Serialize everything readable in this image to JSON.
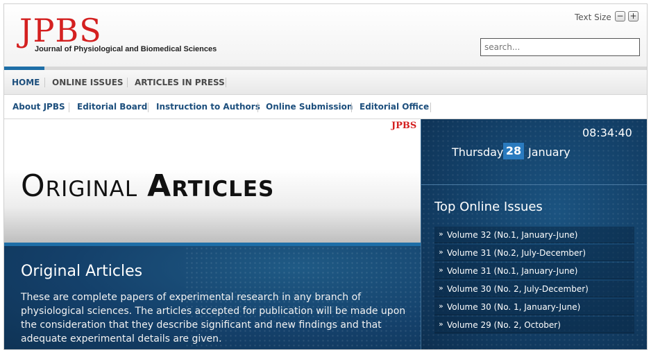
{
  "brand": {
    "logo": "JPBS",
    "subtitle": "Journal of Physiological and Biomedical Sciences",
    "color": "#d42020"
  },
  "header": {
    "text_size_label": "Text Size",
    "decrease_glyph": "−",
    "increase_glyph": "+",
    "search_placeholder": "search..."
  },
  "nav_primary": {
    "active_color": "#1e6ea7",
    "items": [
      {
        "label": "HOME",
        "active": true
      },
      {
        "label": "ONLINE ISSUES",
        "active": false
      },
      {
        "label": "ARTICLES IN PRESS",
        "active": false
      }
    ]
  },
  "nav_secondary": {
    "items": [
      {
        "label": "About JPBS"
      },
      {
        "label": "Editorial Board"
      },
      {
        "label": "Instruction to Authors"
      },
      {
        "label": "Online Submission"
      },
      {
        "label": "Editorial Office"
      }
    ]
  },
  "banner": {
    "brand": "JPBS",
    "title_word1": "Original",
    "title_word2": "Articles"
  },
  "intro": {
    "title": "Original Articles",
    "body": "These are complete papers of experimental research in any branch of physiological sciences. The articles accepted for publication will be made upon the consideration that they describe significant and new findings and that adequate experimental details are given."
  },
  "sidebar": {
    "clock": "08:34:40",
    "date": {
      "day": "Thursday",
      "number": "28",
      "month": "January"
    },
    "top_issues_title": "Top Online Issues",
    "bullet_icon": "double-chevron-right-icon",
    "bullet_glyph": "»",
    "issues": [
      {
        "label": "Volume 32 (No.1, January-June)"
      },
      {
        "label": "Volume 31 (No.2, July-December)"
      },
      {
        "label": "Volume 31 (No.1, January-June)"
      },
      {
        "label": "Volume 30 (No. 2, July-December)"
      },
      {
        "label": "Volume 30 (No. 1, January-June)"
      },
      {
        "label": "Volume 29 (No. 2, October)"
      }
    ]
  }
}
